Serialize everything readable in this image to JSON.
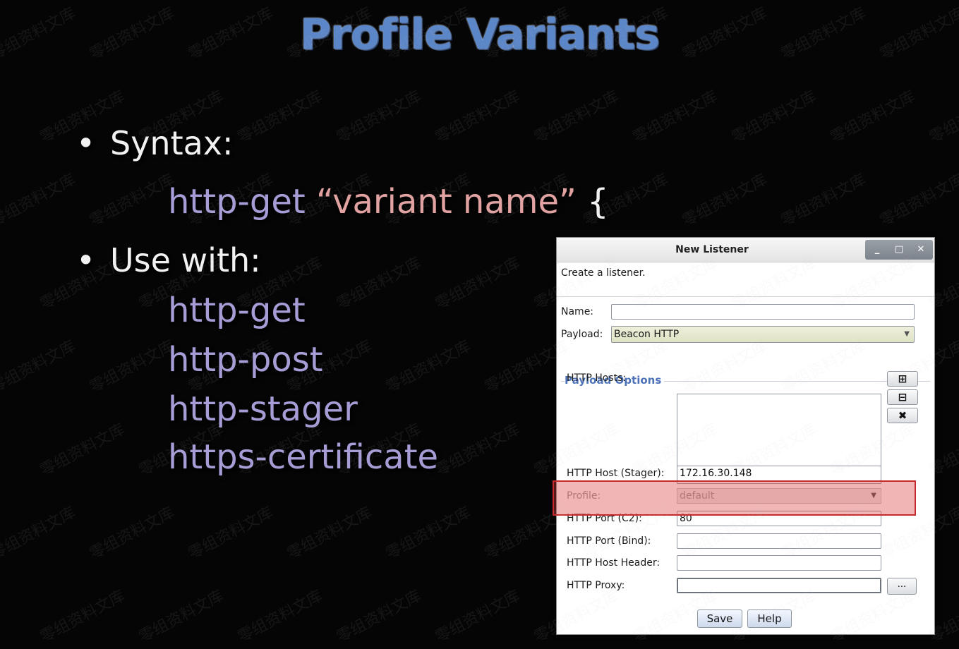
{
  "slide": {
    "title": "Profile Variants",
    "bullet1": "Syntax:",
    "syntax_code": "http-get",
    "syntax_quoted": "“variant name”",
    "syntax_brace": "{",
    "bullet2": "Use with:",
    "items": [
      "http-get",
      "http-post",
      "http-stager",
      "https-certificate"
    ]
  },
  "dialog": {
    "title": "New Listener",
    "controls": {
      "minimize": "_",
      "maximize": "□",
      "close": "✕"
    },
    "intro": "Create a listener.",
    "name_label": "Name:",
    "name_value": "",
    "payload_label": "Payload:",
    "payload_value": "Beacon HTTP",
    "payload_options_title": "Payload Options",
    "hosts_label": "HTTP Hosts:",
    "host_stager_label": "HTTP Host (Stager):",
    "host_stager_value": "172.16.30.148",
    "profile_label": "Profile:",
    "profile_value": "default",
    "port_c2_label": "HTTP Port (C2):",
    "port_c2_value": "80",
    "port_bind_label": "HTTP Port (Bind):",
    "port_bind_value": "",
    "host_header_label": "HTTP Host Header:",
    "host_header_value": "",
    "proxy_label": "HTTP Proxy:",
    "proxy_value": "",
    "proxy_button": "...",
    "save_button": "Save",
    "help_button": "Help"
  },
  "watermark_text": "零组资料文库",
  "colors": {
    "title": "#5b86c8",
    "code": "#a79cd6",
    "quoted": "#e3a2a2",
    "highlight": "#c62a2a"
  }
}
